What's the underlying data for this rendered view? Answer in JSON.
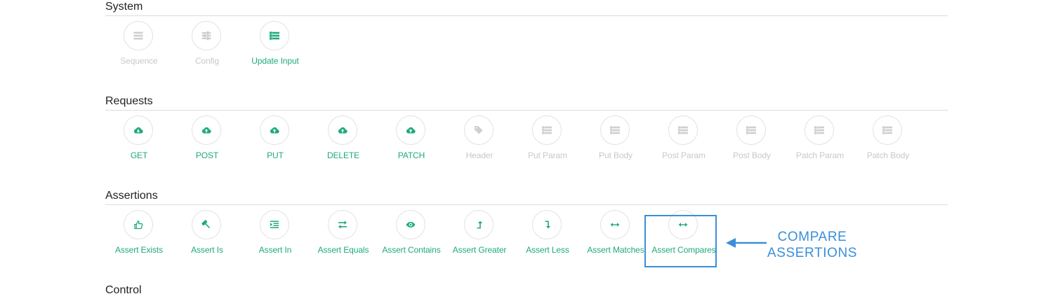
{
  "sections": [
    {
      "title": "System",
      "items": [
        {
          "label": "Sequence",
          "icon": "list-icon",
          "state": "inactive"
        },
        {
          "label": "Config",
          "icon": "sliders-icon",
          "state": "inactive"
        },
        {
          "label": "Update Input",
          "icon": "bullet-list-icon",
          "state": "active"
        }
      ]
    },
    {
      "title": "Requests",
      "items": [
        {
          "label": "GET",
          "icon": "cloud-download-icon",
          "state": "active"
        },
        {
          "label": "POST",
          "icon": "cloud-upload-icon",
          "state": "active"
        },
        {
          "label": "PUT",
          "icon": "cloud-upload-icon",
          "state": "active"
        },
        {
          "label": "DELETE",
          "icon": "cloud-upload-icon",
          "state": "active"
        },
        {
          "label": "PATCH",
          "icon": "cloud-upload-icon",
          "state": "active"
        },
        {
          "label": "Header",
          "icon": "tags-icon",
          "state": "inactive"
        },
        {
          "label": "Put Param",
          "icon": "bullet-list-icon",
          "state": "inactive"
        },
        {
          "label": "Put Body",
          "icon": "bullet-list-icon",
          "state": "inactive"
        },
        {
          "label": "Post Param",
          "icon": "bullet-list-icon",
          "state": "inactive"
        },
        {
          "label": "Post Body",
          "icon": "bullet-list-icon",
          "state": "inactive"
        },
        {
          "label": "Patch Param",
          "icon": "bullet-list-icon",
          "state": "inactive"
        },
        {
          "label": "Patch Body",
          "icon": "bullet-list-icon",
          "state": "inactive"
        }
      ]
    },
    {
      "title": "Assertions",
      "items": [
        {
          "label": "Assert Exists",
          "icon": "thumbs-up-icon",
          "state": "active"
        },
        {
          "label": "Assert Is",
          "icon": "gavel-icon",
          "state": "active"
        },
        {
          "label": "Assert In",
          "icon": "indent-icon",
          "state": "active"
        },
        {
          "label": "Assert Equals",
          "icon": "exchange-icon",
          "state": "active"
        },
        {
          "label": "Assert Contains",
          "icon": "eye-icon",
          "state": "active"
        },
        {
          "label": "Assert Greater",
          "icon": "level-up-icon",
          "state": "active"
        },
        {
          "label": "Assert Less",
          "icon": "level-down-icon",
          "state": "active"
        },
        {
          "label": "Assert Matches",
          "icon": "arrows-h-icon",
          "state": "active"
        },
        {
          "label": "Assert Compares",
          "icon": "arrows-h-icon",
          "state": "active"
        }
      ]
    },
    {
      "title": "Control",
      "items": []
    }
  ],
  "callout": {
    "line1": "COMPARE",
    "line2": "ASSERTIONS"
  },
  "colors": {
    "active": "#1eaa7a",
    "inactive": "#c8c8c8",
    "callout": "#3a8fd8"
  }
}
